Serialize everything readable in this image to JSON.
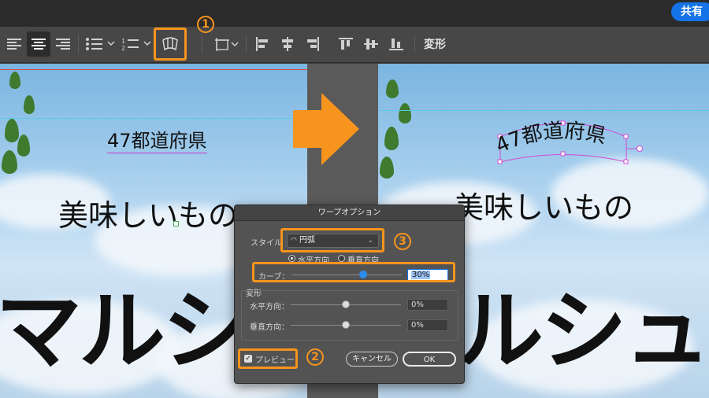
{
  "header": {
    "share_label": "共有"
  },
  "toolbar": {
    "transform_label": "変形",
    "step1": "1"
  },
  "canvas": {
    "left": {
      "prefecture_text": "47都道府県",
      "delicious_text": "美味しいもの",
      "marche_text": "マルシ"
    },
    "right": {
      "prefecture_text": "47都道府県",
      "delicious_text": "美味しいもの",
      "marche_text": "ルシュ"
    }
  },
  "dialog": {
    "title": "ワープオプション",
    "style_label": "スタイル",
    "style_value": "円弧",
    "horizontal_label": "水平方向",
    "vertical_label": "垂直方向",
    "bend_label": "カーブ：",
    "bend_value": "30%",
    "distortion_label": "変形",
    "h_distort_label": "水平方向：",
    "h_distort_value": "0%",
    "v_distort_label": "垂直方向：",
    "v_distort_value": "0%",
    "preview_label": "プレビュー",
    "cancel_label": "キャンセル",
    "ok_label": "OK",
    "step2": "2",
    "step3": "3"
  },
  "colors": {
    "highlight": "#f7941d",
    "accent_blue": "#1473e6",
    "slider_knob": "#2d8ceb"
  },
  "sliders": {
    "bend_percent": 30,
    "h_distort_percent": 0,
    "v_distort_percent": 0
  }
}
